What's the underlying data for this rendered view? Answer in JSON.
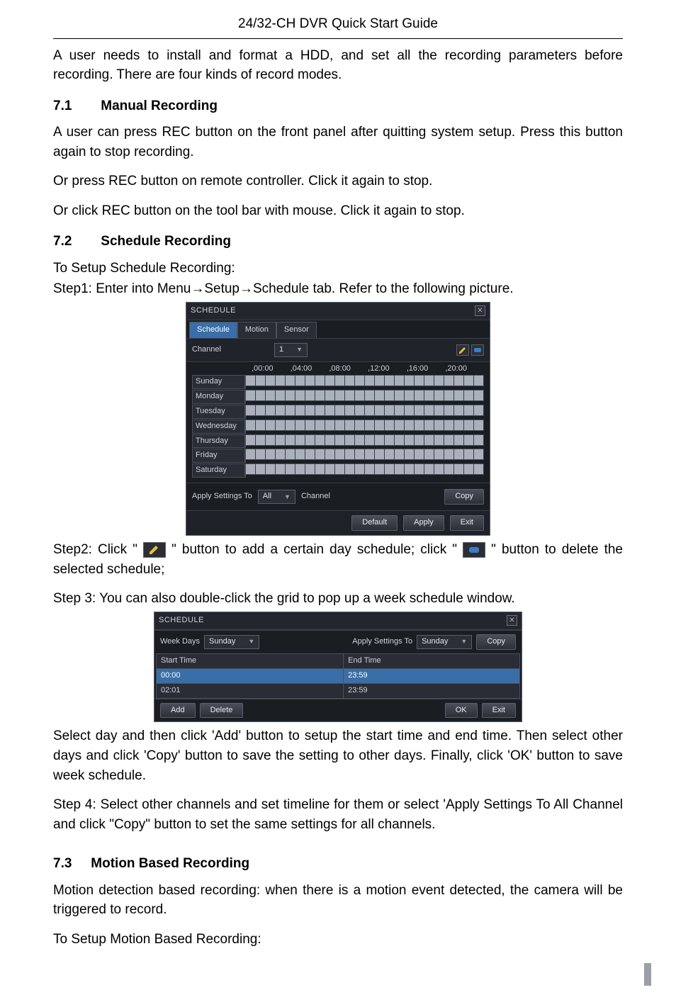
{
  "header": {
    "title": "24/32-CH DVR Quick Start Guide"
  },
  "intro": {
    "text": "A user needs to install and format a HDD, and set all the recording parameters before recording. There are four kinds of record modes."
  },
  "s71": {
    "num": "7.1",
    "title": "Manual Recording",
    "p1": "A user can press REC button on the front panel after quitting system setup. Press this button again to stop recording.",
    "p2": "Or press REC button on remote controller. Click it again to stop.",
    "p3": "Or click REC button on the tool bar with mouse. Click it again to stop."
  },
  "s72": {
    "num": "7.2",
    "title": "Schedule Recording",
    "p1": "To Setup Schedule Recording:",
    "p2": "Step1: Enter into Menu→Setup→Schedule tab. Refer to the following picture.",
    "step2_a": "Step2: Click \"",
    "step2_b": "\" button to add a certain day schedule; click \"",
    "step2_c": "\" button to delete the selected schedule;",
    "step3": "Step 3: You can also double-click the grid to pop up a week schedule window.",
    "p_after1": "Select day and then click 'Add' button to setup the start time and end time. Then select other days and click 'Copy' button to save the setting to other days. Finally, click 'OK' button to save week schedule.",
    "p_after2": "Step 4: Select other channels and set timeline for them or select 'Apply Settings To All Channel and click \"Copy\" button to set the same settings for all channels."
  },
  "s73": {
    "num": "7.3",
    "title": "Motion Based Recording",
    "p1": "Motion detection based recording: when there is a motion event detected, the camera will be triggered to record.",
    "p2": "To Setup Motion Based Recording:"
  },
  "sched1": {
    "window_title": "SCHEDULE",
    "tabs": [
      "Schedule",
      "Motion",
      "Sensor"
    ],
    "channel_label": "Channel",
    "channel_value": "1",
    "time_ticks": [
      ",00:00",
      ",04:00",
      ",08:00",
      ",12:00",
      ",16:00",
      ",20:00"
    ],
    "days": [
      "Sunday",
      "Monday",
      "Tuesday",
      "Wednesday",
      "Thursday",
      "Friday",
      "Saturday"
    ],
    "apply_label": "Apply Settings To",
    "apply_value": "All",
    "channel2_label": "Channel",
    "copy_btn": "Copy",
    "default_btn": "Default",
    "apply_btn": "Apply",
    "exit_btn": "Exit"
  },
  "sched2": {
    "window_title": "SCHEDULE",
    "weekdays_label": "Week Days",
    "weekdays_value": "Sunday",
    "apply_label": "Apply Settings To",
    "apply_value": "Sunday",
    "copy_btn": "Copy",
    "cols": [
      "Start Time",
      "End Time"
    ],
    "rows": [
      {
        "start": "00:00",
        "end": "23:59"
      },
      {
        "start": "02:01",
        "end": "23:59"
      }
    ],
    "add_btn": "Add",
    "delete_btn": "Delete",
    "ok_btn": "OK",
    "exit_btn": "Exit"
  }
}
